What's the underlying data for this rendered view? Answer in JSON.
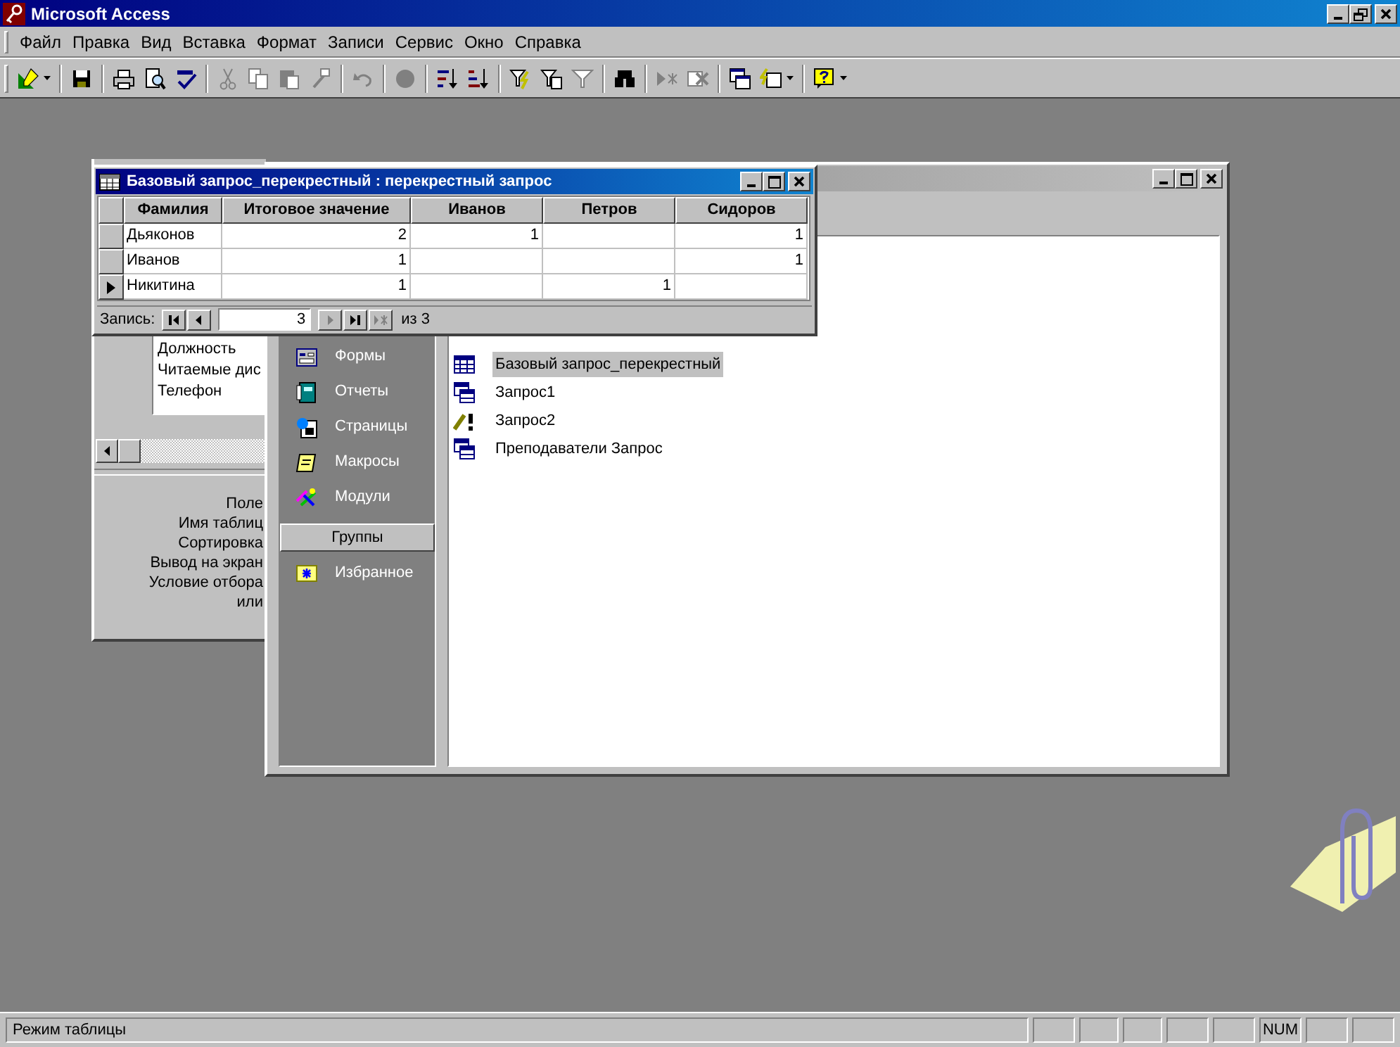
{
  "app": {
    "title": "Microsoft Access"
  },
  "menu": [
    "Файл",
    "Правка",
    "Вид",
    "Вставка",
    "Формат",
    "Записи",
    "Сервис",
    "Окно",
    "Справка"
  ],
  "toolbar": {
    "groups": [
      [
        {
          "kind": "view",
          "disabled": false,
          "dropdown": true
        }
      ],
      [
        {
          "kind": "save",
          "disabled": false,
          "dropdown": false
        }
      ],
      [
        {
          "kind": "print",
          "disabled": false,
          "dropdown": false
        },
        {
          "kind": "preview",
          "disabled": false,
          "dropdown": false
        },
        {
          "kind": "spelling",
          "disabled": false,
          "dropdown": false
        }
      ],
      [
        {
          "kind": "cut",
          "disabled": true,
          "dropdown": false
        },
        {
          "kind": "copy",
          "disabled": true,
          "dropdown": false
        },
        {
          "kind": "paste",
          "disabled": true,
          "dropdown": false
        },
        {
          "kind": "painter",
          "disabled": true,
          "dropdown": false
        }
      ],
      [
        {
          "kind": "undo",
          "disabled": true,
          "dropdown": false
        }
      ],
      [
        {
          "kind": "web",
          "disabled": true,
          "dropdown": false
        }
      ],
      [
        {
          "kind": "sort_asc",
          "disabled": false,
          "dropdown": false
        },
        {
          "kind": "sort_desc",
          "disabled": false,
          "dropdown": false
        }
      ],
      [
        {
          "kind": "filter_selection",
          "disabled": false,
          "dropdown": false
        },
        {
          "kind": "filter_form",
          "disabled": false,
          "dropdown": false
        },
        {
          "kind": "apply_filter",
          "disabled": true,
          "dropdown": false
        }
      ],
      [
        {
          "kind": "find",
          "disabled": false,
          "dropdown": false
        }
      ],
      [
        {
          "kind": "new_record",
          "disabled": true,
          "dropdown": false
        },
        {
          "kind": "delete_record",
          "disabled": true,
          "dropdown": false
        }
      ],
      [
        {
          "kind": "db_window",
          "disabled": false,
          "dropdown": false
        },
        {
          "kind": "new_object",
          "disabled": false,
          "dropdown": true
        }
      ],
      [
        {
          "kind": "help",
          "disabled": false,
          "dropdown": true
        }
      ]
    ]
  },
  "query_window": {
    "title": "Базовый запрос_перекрестный : перекрестный запрос",
    "columns": [
      "Фамилия",
      "Итоговое значение",
      "Иванов",
      "Петров",
      "Сидоров"
    ],
    "rows": [
      {
        "cells": [
          "Дьяконов",
          "2",
          "1",
          null,
          "1"
        ],
        "current": false
      },
      {
        "cells": [
          "Иванов",
          "1",
          null,
          null,
          "1"
        ],
        "current": false
      },
      {
        "cells": [
          "Никитина",
          "1",
          null,
          "1",
          null
        ],
        "current": true
      }
    ],
    "navigator": {
      "label": "Запись:",
      "before": [
        {
          "kind": "first",
          "disabled": false
        },
        {
          "kind": "previous",
          "disabled": false
        }
      ],
      "record": "3",
      "after": [
        {
          "kind": "next",
          "disabled": true
        },
        {
          "kind": "last",
          "disabled": false
        },
        {
          "kind": "new",
          "disabled": true
        }
      ],
      "total": "из 3"
    }
  },
  "design_window": {
    "fields": [
      "Должность",
      "Читаемые дис",
      "Телефон"
    ],
    "grid_rows": [
      "Поле",
      "Имя таблиц",
      "Сортировка",
      "Вывод на экран",
      "Условие отбора",
      "или"
    ]
  },
  "database_window": {
    "objects": [
      {
        "kind": "forms",
        "label": "Формы"
      },
      {
        "kind": "reports",
        "label": "Отчеты"
      },
      {
        "kind": "pages",
        "label": "Страницы"
      },
      {
        "kind": "macros",
        "label": "Макросы"
      },
      {
        "kind": "modules",
        "label": "Модули"
      }
    ],
    "groups_button": "Группы",
    "groups": [
      {
        "kind": "favorites",
        "label": "Избранное"
      }
    ],
    "items": [
      {
        "kind": "crosstab",
        "label": "Базовый запрос_перекрестный",
        "selected": true
      },
      {
        "kind": "select",
        "label": "Запрос1",
        "selected": false
      },
      {
        "kind": "update",
        "label": "Запрос2",
        "selected": false
      },
      {
        "kind": "select",
        "label": "Преподаватели Запрос",
        "selected": false
      }
    ]
  },
  "status_bar": {
    "text": "Режим таблицы",
    "num": "NUM"
  }
}
